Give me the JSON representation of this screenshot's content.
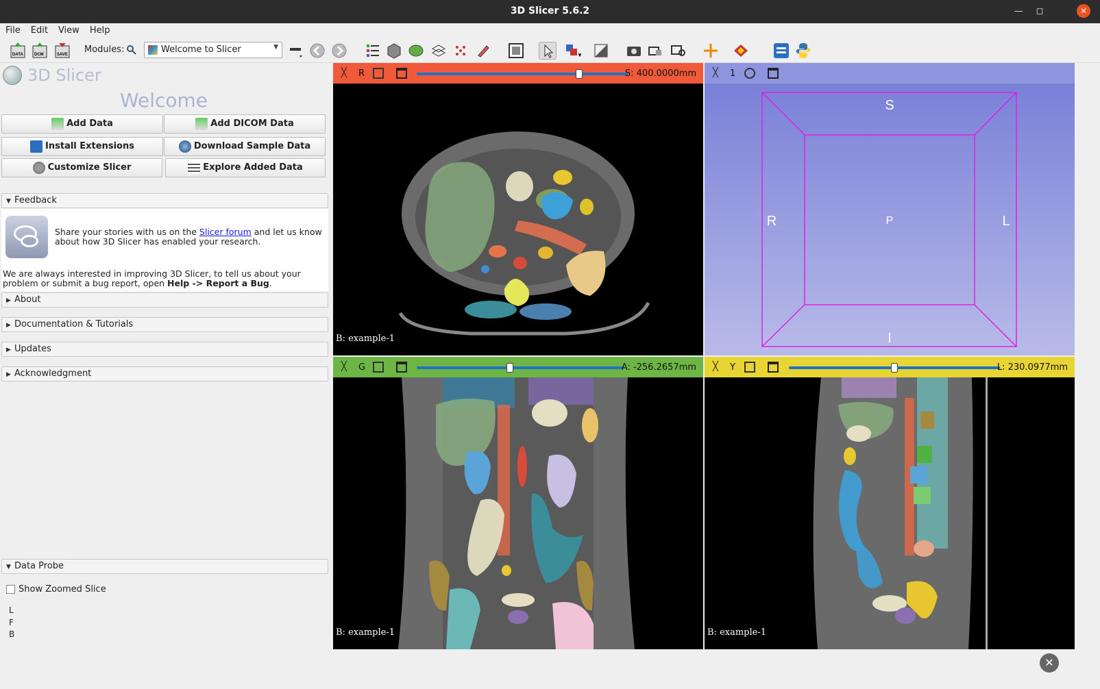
{
  "window": {
    "title": "3D Slicer 5.6.2"
  },
  "menu": [
    "File",
    "Edit",
    "View",
    "Help"
  ],
  "toolbar": {
    "modules_label": "Modules:",
    "module_selected": "Welcome to Slicer"
  },
  "welcome": {
    "app_name": "3D Slicer",
    "heading": "Welcome",
    "buttons": {
      "add_data": "Add Data",
      "add_dicom": "Add DICOM Data",
      "install_ext": "Install Extensions",
      "download_sample": "Download Sample Data",
      "customize": "Customize Slicer",
      "explore": "Explore Added Data"
    }
  },
  "sections": {
    "feedback": "Feedback",
    "about": "About",
    "docs": "Documentation & Tutorials",
    "updates": "Updates",
    "ack": "Acknowledgment",
    "probe": "Data Probe"
  },
  "feedback": {
    "line1_pre": "Share your stories with us on the ",
    "link": "Slicer forum",
    "line1_post": " and let us know about how 3D Slicer has enabled your research.",
    "line2_pre": "We are always interested in improving 3D Slicer, to tell us about your problem or submit a bug report, open ",
    "line2_bold": "Help -> Report a Bug",
    "line2_post": "."
  },
  "probe": {
    "show_zoomed": "Show Zoomed Slice",
    "rows": [
      "L",
      "F",
      "B"
    ]
  },
  "views": {
    "red": {
      "label": "R",
      "value": "S: 400.0000mm",
      "slider_pos": 0.77,
      "bg_label": "B: example-1",
      "color": "#f05a3a"
    },
    "threed": {
      "label": "1",
      "color": "#8e94de",
      "s": "S",
      "i": "I",
      "r": "R",
      "l": "L",
      "p": "P"
    },
    "green": {
      "label": "G",
      "value": "A: -256.2657mm",
      "slider_pos": 0.45,
      "bg_label": "B: example-1",
      "color": "#6db545"
    },
    "yellow": {
      "label": "Y",
      "value": "L: 230.0977mm",
      "slider_pos": 0.5,
      "bg_label": "B: example-1",
      "color": "#e8d433"
    }
  }
}
